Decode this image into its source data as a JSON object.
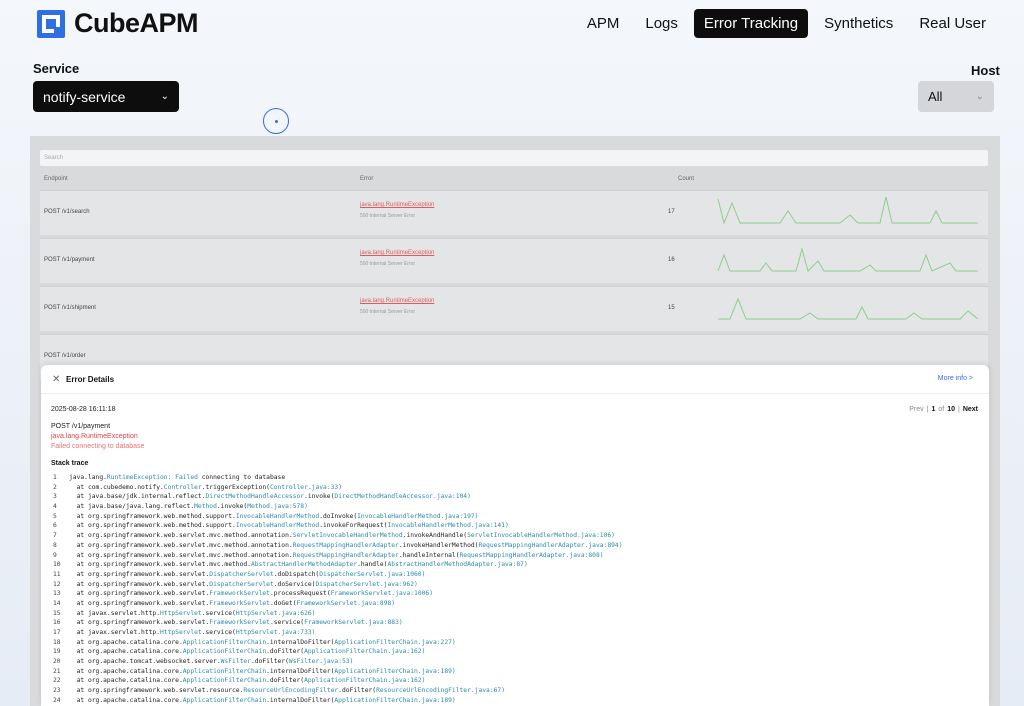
{
  "brand": {
    "name": "CubeAPM"
  },
  "nav": [
    {
      "label": "APM",
      "active": false
    },
    {
      "label": "Logs",
      "active": false
    },
    {
      "label": "Error Tracking",
      "active": true
    },
    {
      "label": "Synthetics",
      "active": false
    },
    {
      "label": "Real User",
      "active": false
    }
  ],
  "filters": {
    "service_label": "Service",
    "service_value": "notify-service",
    "host_label": "Host",
    "host_value": "All"
  },
  "table": {
    "search_placeholder": "Search",
    "headers": [
      "Endpoint",
      "Error",
      "Count"
    ],
    "rows": [
      {
        "endpoint": "POST /v1/search",
        "error": "java.lang.RuntimeException",
        "error_sub": "500 Internal Server Error",
        "count": "17"
      },
      {
        "endpoint": "POST /v1/payment",
        "error": "java.lang.RuntimeException",
        "error_sub": "500 Internal Server Error",
        "count": "16"
      },
      {
        "endpoint": "POST /v1/shipment",
        "error": "java.lang.RuntimeException",
        "error_sub": "500 Internal Server Error",
        "count": "15"
      },
      {
        "endpoint": "POST /v1/order",
        "error": "",
        "error_sub": "",
        "count": ""
      }
    ]
  },
  "modal": {
    "title": "Error Details",
    "more_info": "More info >",
    "timestamp": "2025-08-28 16:11:18",
    "pager": {
      "prev": "Prev",
      "current": "1",
      "of": "of",
      "total": "10",
      "next": "Next"
    },
    "endpoint": "POST /v1/payment",
    "exception": "java.lang.RuntimeException",
    "message": "Failed connecting to database",
    "stack_title": "Stack trace",
    "stack": [
      [
        "java.lang.",
        "RuntimeException: Failed",
        " connecting to database",
        ""
      ],
      [
        "  at com.cubedemo.notify.",
        "Controller",
        ".triggerException(",
        "Controller.java:33)"
      ],
      [
        "  at java.base/jdk.internal.reflect.",
        "DirectMethodHandleAccessor",
        ".invoke(",
        "DirectMethodHandleAccessor.java:104)"
      ],
      [
        "  at java.base/java.lang.reflect.",
        "Method",
        ".invoke(",
        "Method.java:578)"
      ],
      [
        "  at org.springframework.web.method.support.",
        "InvocableHandlerMethod",
        ".doInvoke(",
        "InvocableHandlerMethod.java:197)"
      ],
      [
        "  at org.springframework.web.method.support.",
        "InvocableHandlerMethod",
        ".invokeForRequest(",
        "InvocableHandlerMethod.java:141)"
      ],
      [
        "  at org.springframework.web.servlet.mvc.method.annotation.",
        "ServletInvocableHandlerMethod",
        ".invokeAndHandle(",
        "ServletInvocableHandlerMethod.java:106)"
      ],
      [
        "  at org.springframework.web.servlet.mvc.method.annotation.",
        "RequestMappingHandlerAdapter",
        ".invokeHandlerMethod(",
        "RequestMappingHandlerAdapter.java:894)"
      ],
      [
        "  at org.springframework.web.servlet.mvc.method.annotation.",
        "RequestMappingHandlerAdapter",
        ".handleInternal(",
        "RequestMappingHandlerAdapter.java:808)"
      ],
      [
        "  at org.springframework.web.servlet.mvc.method.",
        "AbstractHandlerMethodAdapter",
        ".handle(",
        "AbstractHandlerMethodAdapter.java:87)"
      ],
      [
        "  at org.springframework.web.servlet.",
        "DispatcherServlet",
        ".doDispatch(",
        "DispatcherServlet.java:1060)"
      ],
      [
        "  at org.springframework.web.servlet.",
        "DispatcherServlet",
        ".doService(",
        "DispatcherServlet.java:962)"
      ],
      [
        "  at org.springframework.web.servlet.",
        "FrameworkServlet",
        ".processRequest(",
        "FrameworkServlet.java:1006)"
      ],
      [
        "  at org.springframework.web.servlet.",
        "FrameworkServlet",
        ".doGet(",
        "FrameworkServlet.java:898)"
      ],
      [
        "  at javax.servlet.http.",
        "HttpServlet",
        ".service(",
        "HttpServlet.java:626)"
      ],
      [
        "  at org.springframework.web.servlet.",
        "FrameworkServlet",
        ".service(",
        "FrameworkServlet.java:883)"
      ],
      [
        "  at javax.servlet.http.",
        "HttpServlet",
        ".service(",
        "HttpServlet.java:733)"
      ],
      [
        "  at org.apache.catalina.core.",
        "ApplicationFilterChain",
        ".internalDoFilter(",
        "ApplicationFilterChain.java:227)"
      ],
      [
        "  at org.apache.catalina.core.",
        "ApplicationFilterChain",
        ".doFilter(",
        "ApplicationFilterChain.java:162)"
      ],
      [
        "  at org.apache.tomcat.websocket.server.",
        "WsFilter",
        ".doFilter(",
        "WsFilter.java:53)"
      ],
      [
        "  at org.apache.catalina.core.",
        "ApplicationFilterChain",
        ".internalDoFilter(",
        "ApplicationFilterChain.java:189)"
      ],
      [
        "  at org.apache.catalina.core.",
        "ApplicationFilterChain",
        ".doFilter(",
        "ApplicationFilterChain.java:162)"
      ],
      [
        "  at org.springframework.web.servlet.resource.",
        "ResourceUrlEncodingFilter",
        ".doFilter(",
        "ResourceUrlEncodingFilter.java:67)"
      ],
      [
        "  at org.apache.catalina.core.",
        "ApplicationFilterChain",
        ".internalDoFilter(",
        "ApplicationFilterChain.java:189)"
      ]
    ]
  },
  "colors": {
    "accent": "#3b6de0",
    "error": "#e24545",
    "code_highlight": "#2c8aa8",
    "sparkline": "#7bc07b"
  }
}
